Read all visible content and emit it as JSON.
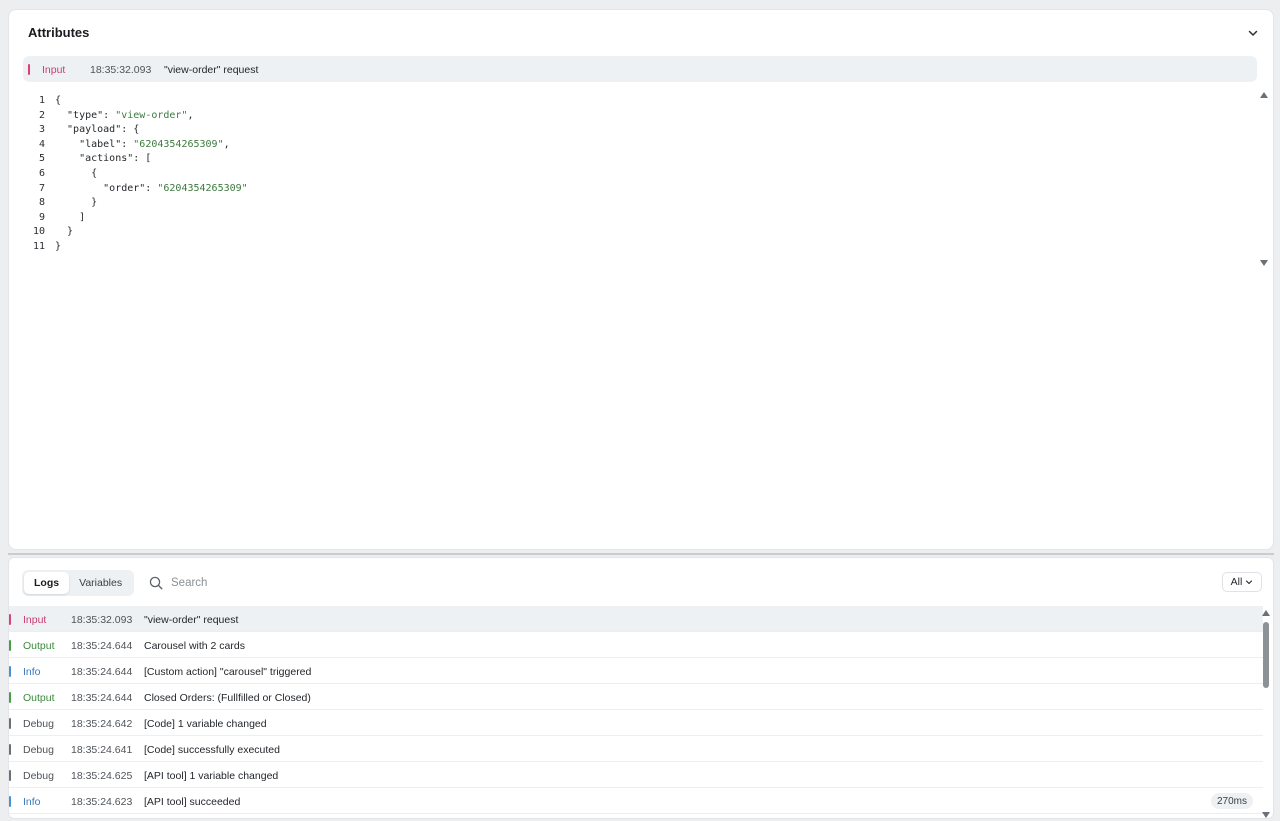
{
  "attributes": {
    "title": "Attributes",
    "selected": {
      "level": "Input",
      "timestamp": "18:35:32.093",
      "message": "\"view-order\" request"
    },
    "code_lines": [
      {
        "n": "1",
        "pre": "{",
        "str": "",
        "post": ""
      },
      {
        "n": "2",
        "pre": "  \"type\": ",
        "str": "\"view-order\"",
        "post": ","
      },
      {
        "n": "3",
        "pre": "  \"payload\": {",
        "str": "",
        "post": ""
      },
      {
        "n": "4",
        "pre": "    \"label\": ",
        "str": "\"6204354265309\"",
        "post": ","
      },
      {
        "n": "5",
        "pre": "    \"actions\": [",
        "str": "",
        "post": ""
      },
      {
        "n": "6",
        "pre": "      {",
        "str": "",
        "post": ""
      },
      {
        "n": "7",
        "pre": "        \"order\": ",
        "str": "\"6204354265309\"",
        "post": ""
      },
      {
        "n": "8",
        "pre": "      }",
        "str": "",
        "post": ""
      },
      {
        "n": "9",
        "pre": "    ]",
        "str": "",
        "post": ""
      },
      {
        "n": "10",
        "pre": "  }",
        "str": "",
        "post": ""
      },
      {
        "n": "11",
        "pre": "}",
        "str": "",
        "post": ""
      }
    ]
  },
  "logs": {
    "tabs": [
      "Logs",
      "Variables"
    ],
    "active_tab": "Logs",
    "search_placeholder": "Search",
    "filter_value": "All",
    "rows": [
      {
        "level": "Input",
        "timestamp": "18:35:32.093",
        "message": "\"view-order\" request",
        "duration": "",
        "selected": true
      },
      {
        "level": "Output",
        "timestamp": "18:35:24.644",
        "message": "Carousel with 2 cards",
        "duration": "",
        "selected": false
      },
      {
        "level": "Info",
        "timestamp": "18:35:24.644",
        "message": "[Custom action] \"carousel\" triggered",
        "duration": "",
        "selected": false
      },
      {
        "level": "Output",
        "timestamp": "18:35:24.644",
        "message": "Closed Orders: (Fullfilled or Closed)",
        "duration": "",
        "selected": false
      },
      {
        "level": "Debug",
        "timestamp": "18:35:24.642",
        "message": "[Code] 1 variable changed",
        "duration": "",
        "selected": false
      },
      {
        "level": "Debug",
        "timestamp": "18:35:24.641",
        "message": "[Code] successfully executed",
        "duration": "",
        "selected": false
      },
      {
        "level": "Debug",
        "timestamp": "18:35:24.625",
        "message": "[API tool] 1 variable changed",
        "duration": "",
        "selected": false
      },
      {
        "level": "Info",
        "timestamp": "18:35:24.623",
        "message": "[API tool] succeeded",
        "duration": "270ms",
        "selected": false
      }
    ]
  },
  "level_colors": {
    "Input": {
      "text": "#c93d6f",
      "bar": "#d7427a"
    },
    "Output": {
      "text": "#3b8a3e",
      "bar": "#43a047"
    },
    "Info": {
      "text": "#3a78b5",
      "bar": "#4a8fd4"
    },
    "Debug": {
      "text": "#4e545a",
      "bar": "#6b7076"
    }
  },
  "icons": {
    "collapse": "chevron-down-icon",
    "search": "search-icon",
    "filter": "chevron-down-icon"
  }
}
